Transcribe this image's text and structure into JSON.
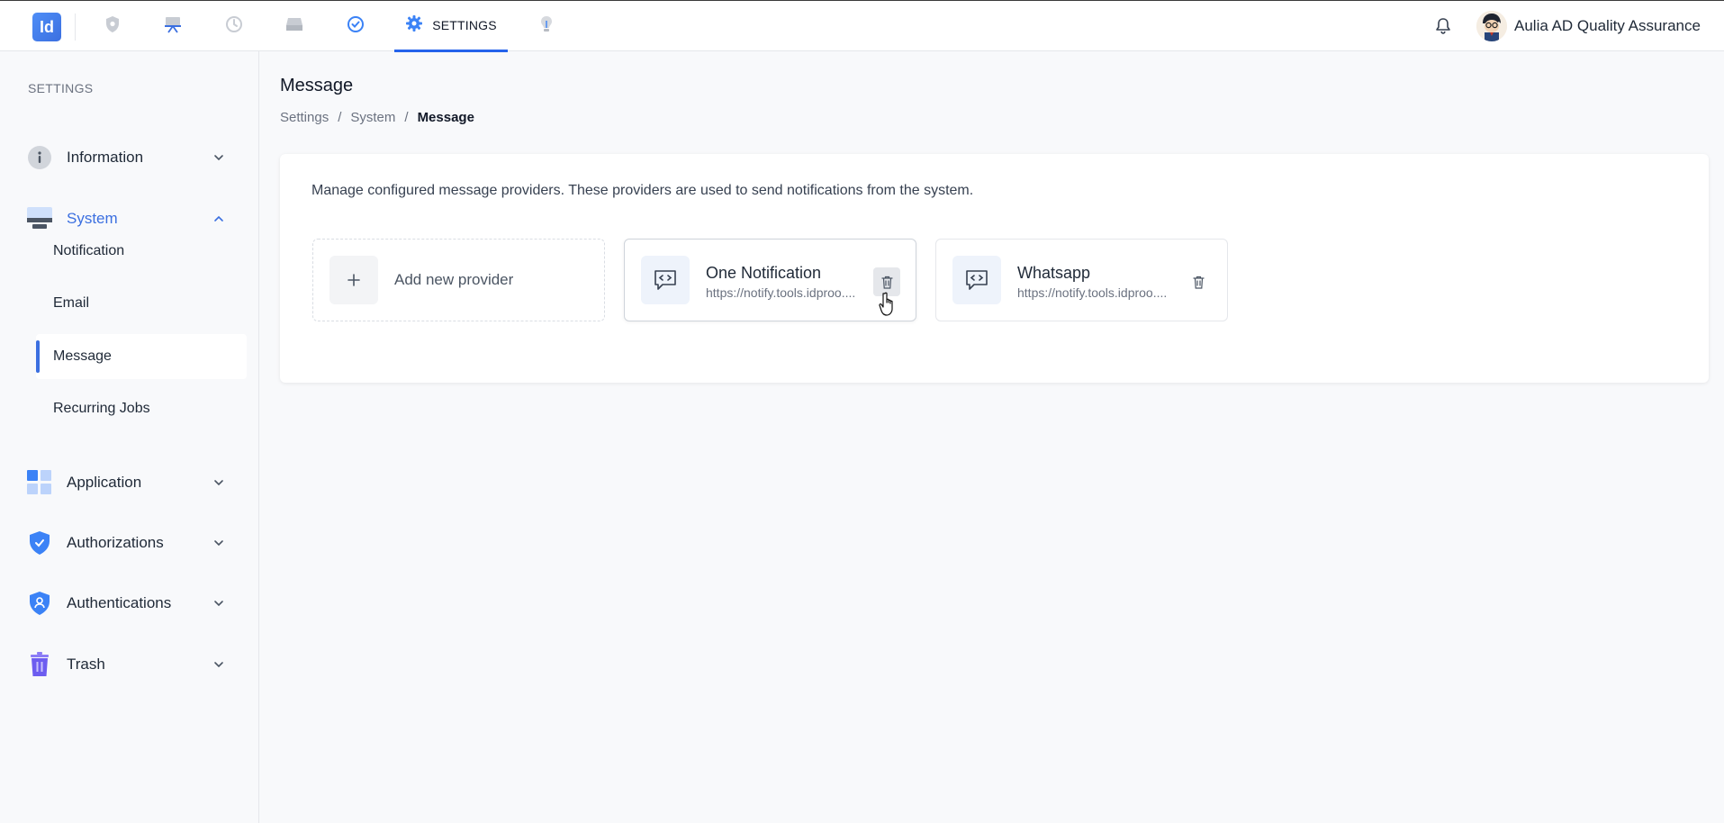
{
  "topbar": {
    "logo_text": "Id",
    "nav_icons": [
      "shield-icon",
      "presentation-icon",
      "history-icon",
      "drive-icon",
      "check-circle-icon",
      "gear-icon",
      "lightbulb-icon"
    ],
    "active_tab_label": "SETTINGS",
    "user_name": "Aulia AD Quality Assurance",
    "accent_color": "#2563eb"
  },
  "sidebar": {
    "heading": "SETTINGS",
    "groups": [
      {
        "label": "Information",
        "icon": "info-icon"
      },
      {
        "label": "System",
        "icon": "monitor-icon",
        "expanded": true
      },
      {
        "label": "Application",
        "icon": "grid-icon"
      },
      {
        "label": "Authorizations",
        "icon": "shield-check-icon"
      },
      {
        "label": "Authentications",
        "icon": "shield-user-icon"
      },
      {
        "label": "Trash",
        "icon": "trash-icon"
      }
    ],
    "system_items": [
      {
        "label": "Notification"
      },
      {
        "label": "Email"
      },
      {
        "label": "Message",
        "active": true
      },
      {
        "label": "Recurring Jobs"
      }
    ]
  },
  "main": {
    "title": "Message",
    "breadcrumb": [
      "Settings",
      "System",
      "Message"
    ],
    "description": "Manage configured message providers. These providers are used to send notifications from the system.",
    "add_label": "Add new provider",
    "providers": [
      {
        "name": "One Notification",
        "url": "https://notify.tools.idproo...."
      },
      {
        "name": "Whatsapp",
        "url": "https://notify.tools.idproo...."
      }
    ]
  }
}
